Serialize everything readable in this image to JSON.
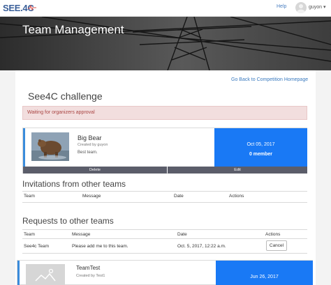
{
  "nav": {
    "logo_text": "SEE.4C",
    "help_label": "Help",
    "user_label": "guyon ▾"
  },
  "hero": {
    "title": "Team Management"
  },
  "back_link": "Go Back to Competition Homepage",
  "challenge_title": "See4C challenge",
  "alert_text": "Waiting for organizers approval",
  "team_card": {
    "name": "Big Bear",
    "created_by": "Created by guyon",
    "description": "Best team.",
    "date": "Oct 05, 2017",
    "members": "0 member",
    "delete_label": "Delete",
    "edit_label": "Edit"
  },
  "invitations": {
    "title": "Invitations from other teams",
    "columns": [
      "Team",
      "Message",
      "Date",
      "Actions"
    ]
  },
  "requests": {
    "title": "Requests to other teams",
    "columns": [
      "Team",
      "Message",
      "Date",
      "Actions"
    ],
    "rows": [
      {
        "team": "See4c Team",
        "message": "Please add me to this team.",
        "date": "Oct. 5, 2017, 12:22 a.m.",
        "action": "Cancel"
      }
    ]
  },
  "team_card_2": {
    "name": "TeamTest",
    "created_by": "Created by Test1",
    "description": "",
    "date": "Jun 26, 2017"
  },
  "colors": {
    "accent_blue": "#1979f5",
    "alert_bg": "#f2dede",
    "alert_text": "#a94442",
    "button_gray": "#5b5d6a"
  }
}
